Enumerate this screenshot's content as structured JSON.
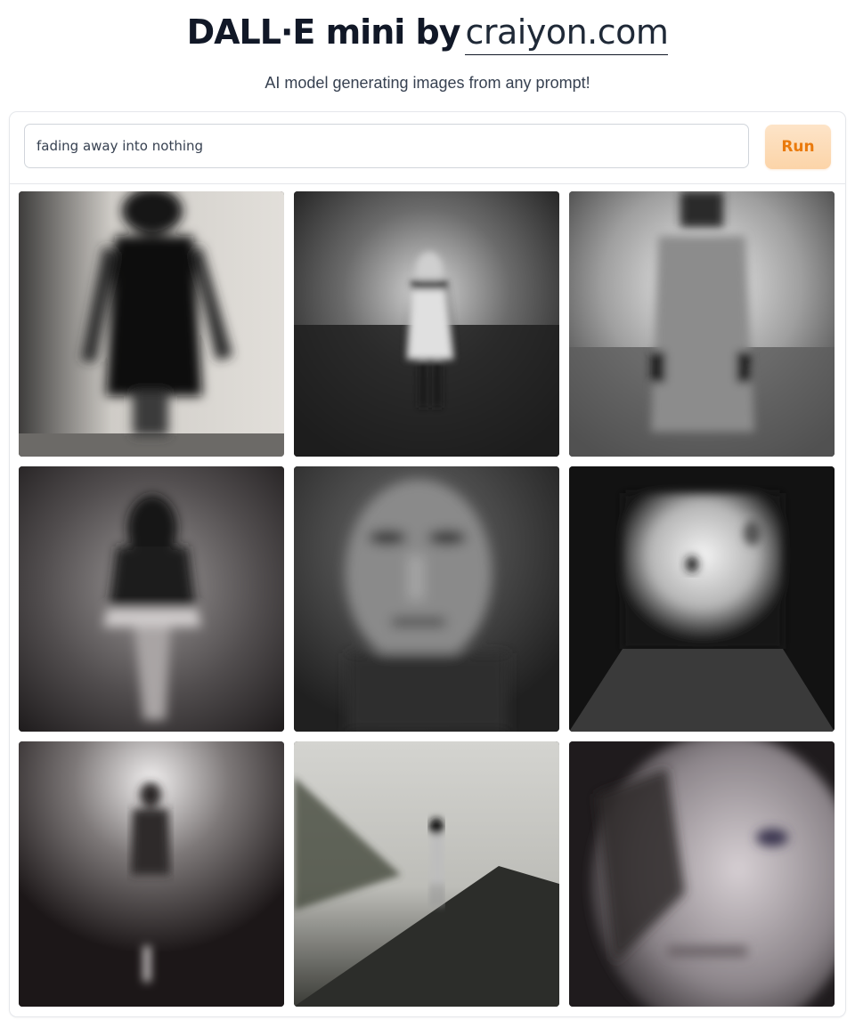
{
  "header": {
    "title_bold": "DALL·E mini by",
    "title_link": "craiyon.com",
    "subtitle": "AI model generating images from any prompt!"
  },
  "prompt": {
    "value": "fading away into nothing"
  },
  "run_button": {
    "label": "Run"
  },
  "images": {
    "count": 9,
    "columns": 3,
    "style": "grayscale blurred figures"
  },
  "colors": {
    "accent_text": "#ea7a0c",
    "accent_bg": "#fcd4a8",
    "border": "#e5e7eb"
  }
}
